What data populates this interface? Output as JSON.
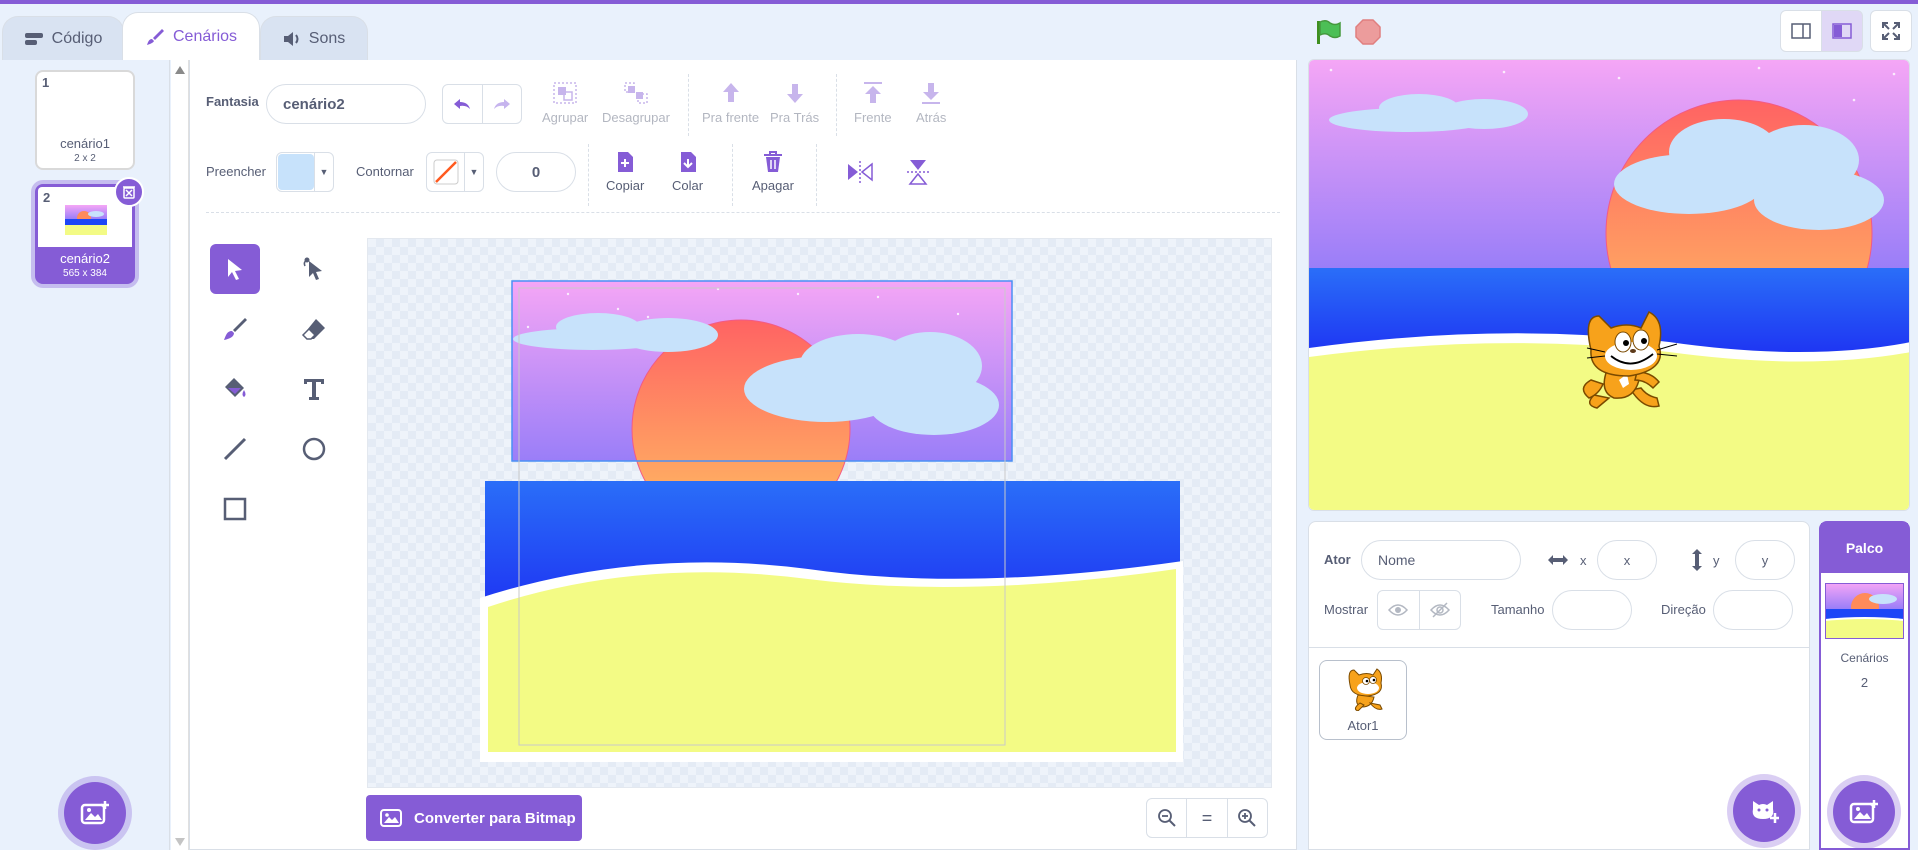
{
  "tabs": [
    {
      "label": "Código",
      "icon": "code-icon"
    },
    {
      "label": "Cenários",
      "icon": "brush-icon"
    },
    {
      "label": "Sons",
      "icon": "speaker-icon"
    }
  ],
  "costumes": [
    {
      "number": "1",
      "name": "cenário1",
      "size": "2 x 2"
    },
    {
      "number": "2",
      "name": "cenário2",
      "size": "565 x 384"
    }
  ],
  "editor": {
    "costume_label": "Fantasia",
    "costume_name": "cenário2",
    "buttons": {
      "group": "Agrupar",
      "ungroup": "Desagrupar",
      "forward": "Pra frente",
      "backward": "Pra Trás",
      "front": "Frente",
      "back": "Atrás",
      "copy": "Copiar",
      "paste": "Colar",
      "delete": "Apagar"
    },
    "fill_label": "Preencher",
    "fill_color": "#c7e2fb",
    "outline_label": "Contornar",
    "outline_width": "0",
    "convert_button": "Converter para Bitmap",
    "zoom_reset": "="
  },
  "sprite_info": {
    "sprite_label": "Ator",
    "name_placeholder": "Nome",
    "x_label": "x",
    "x_placeholder": "x",
    "y_label": "y",
    "y_placeholder": "y",
    "show_label": "Mostrar",
    "size_label": "Tamanho",
    "direction_label": "Direção"
  },
  "sprites": [
    {
      "name": "Ator1"
    }
  ],
  "stage_selector": {
    "header": "Palco",
    "backdrops_label": "Cenários",
    "backdrops_count": "2"
  },
  "colors": {
    "accent": "#855cd6",
    "sky_top": "#f5a6f6",
    "sky_bottom": "#9a7ef8",
    "sea": "#1d46f7",
    "sand": "#f3fb85",
    "cloud": "#c7e2fb"
  }
}
